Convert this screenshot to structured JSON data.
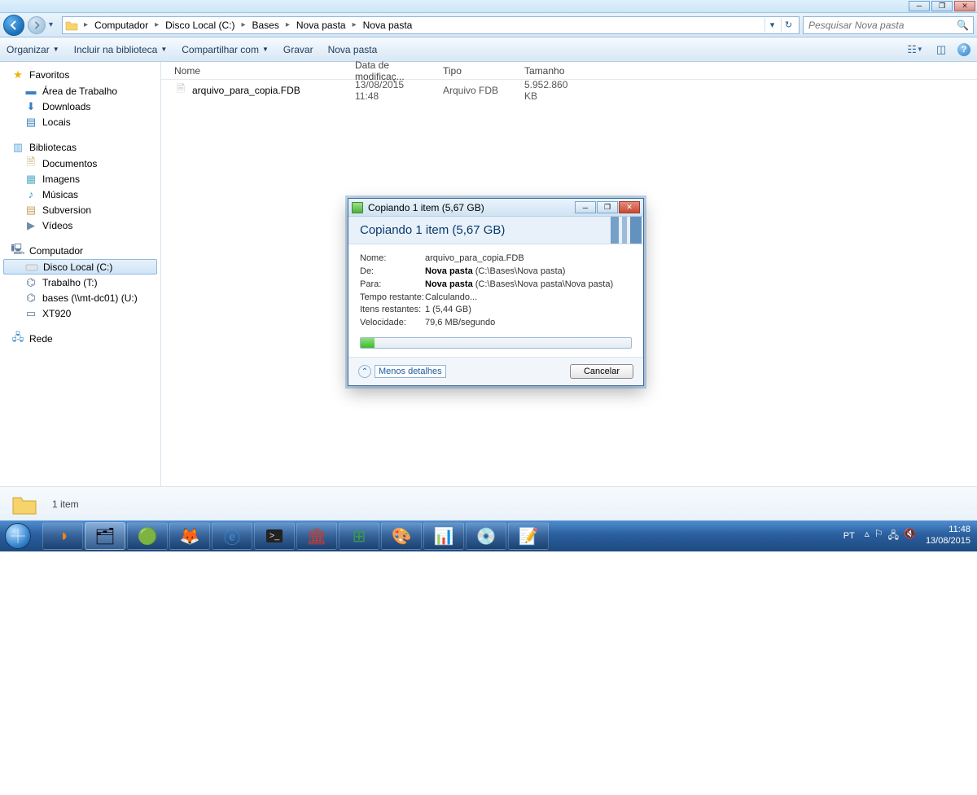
{
  "window": {
    "bc_computador": "Computador",
    "bc_disco": "Disco Local (C:)",
    "bc_bases": "Bases",
    "bc_np1": "Nova pasta",
    "bc_np2": "Nova pasta",
    "search_placeholder": "Pesquisar Nova pasta"
  },
  "toolbar": {
    "organizar": "Organizar",
    "incluir": "Incluir na biblioteca",
    "compartilhar": "Compartilhar com",
    "gravar": "Gravar",
    "nova_pasta": "Nova pasta"
  },
  "sidebar": {
    "favoritos": "Favoritos",
    "area_trabalho": "Área de Trabalho",
    "downloads": "Downloads",
    "locais": "Locais",
    "bibliotecas": "Bibliotecas",
    "documentos": "Documentos",
    "imagens": "Imagens",
    "musicas": "Músicas",
    "subversion": "Subversion",
    "videos": "Vídeos",
    "computador": "Computador",
    "disco_c": "Disco Local (C:)",
    "trabalho_t": "Trabalho (T:)",
    "bases_u": "bases (\\\\mt-dc01) (U:)",
    "xt920": "XT920",
    "rede": "Rede"
  },
  "columns": {
    "nome": "Nome",
    "data": "Data de modificaç...",
    "tipo": "Tipo",
    "tamanho": "Tamanho"
  },
  "file": {
    "name": "arquivo_para_copia.FDB",
    "date": "13/08/2015 11:48",
    "type": "Arquivo FDB",
    "size": "5.952.860 KB"
  },
  "status": {
    "count": "1 item"
  },
  "dialog": {
    "title": "Copiando 1 item (5,67 GB)",
    "banner": "Copiando 1 item (5,67 GB)",
    "l_nome": "Nome:",
    "v_nome": "arquivo_para_copia.FDB",
    "l_de": "De:",
    "v_de_b": "Nova pasta",
    "v_de_rest": " (C:\\Bases\\Nova pasta)",
    "l_para": "Para:",
    "v_para_b": "Nova pasta",
    "v_para_rest": " (C:\\Bases\\Nova pasta\\Nova pasta)",
    "l_tempo": "Tempo restante:",
    "v_tempo": "Calculando...",
    "l_itens": "Itens restantes:",
    "v_itens": "1 (5,44 GB)",
    "l_vel": "Velocidade:",
    "v_vel": "79,6 MB/segundo",
    "menos": "Menos detalhes",
    "cancelar": "Cancelar"
  },
  "taskbar": {
    "lang": "PT",
    "time": "11:48",
    "date": "13/08/2015"
  }
}
